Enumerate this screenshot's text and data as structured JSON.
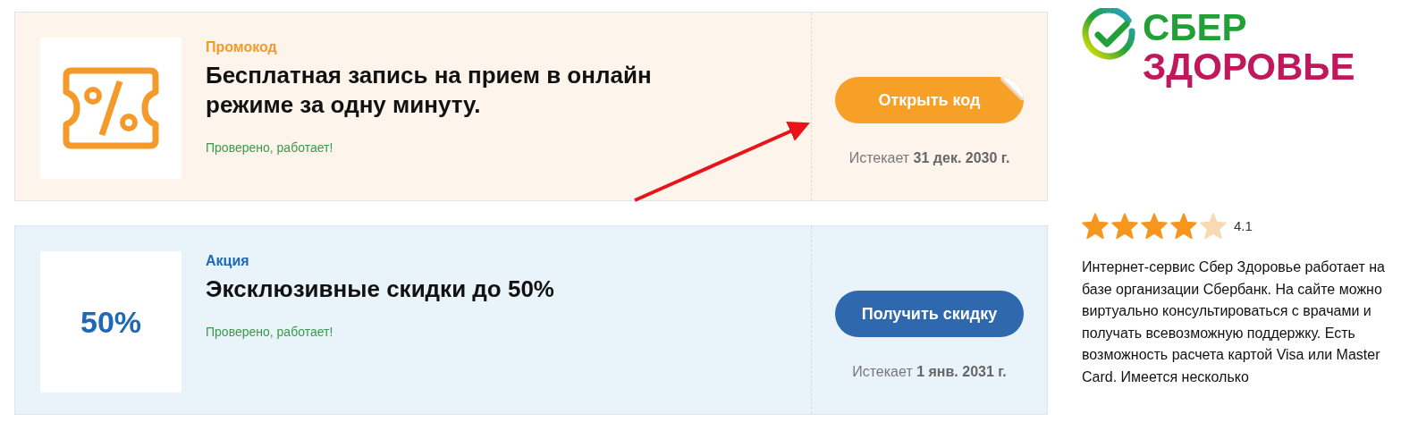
{
  "offers": [
    {
      "kind": "promo",
      "type_label": "Промокод",
      "title": "Бесплатная запись на прием в онлайн режиме за одну минуту.",
      "status": "Проверено, работает!",
      "button": "Открыть код",
      "expires": "Истекает **31 дек. 2030 г.**"
    },
    {
      "kind": "sale",
      "badge": "50%",
      "type_label": "Акция",
      "title": "Эксклюзивные скидки до 50%",
      "status": "Проверено, работает!",
      "button": "Получить скидку",
      "expires": "Истекает **1 янв. 2031 г.**"
    }
  ],
  "sidebar": {
    "logo_top": "СБЕР",
    "logo_bottom": "ЗДОРОВЬЕ",
    "stars": 4,
    "rating": "4.1",
    "description": "Интернет-сервис Сбер Здоровье работает на базе организации Сбербанк. На сайте можно виртуально консультироваться с врачами и получать всевозможную поддержку. Есть возможность расчета картой Visa или Master Card. Имеется несколько"
  }
}
